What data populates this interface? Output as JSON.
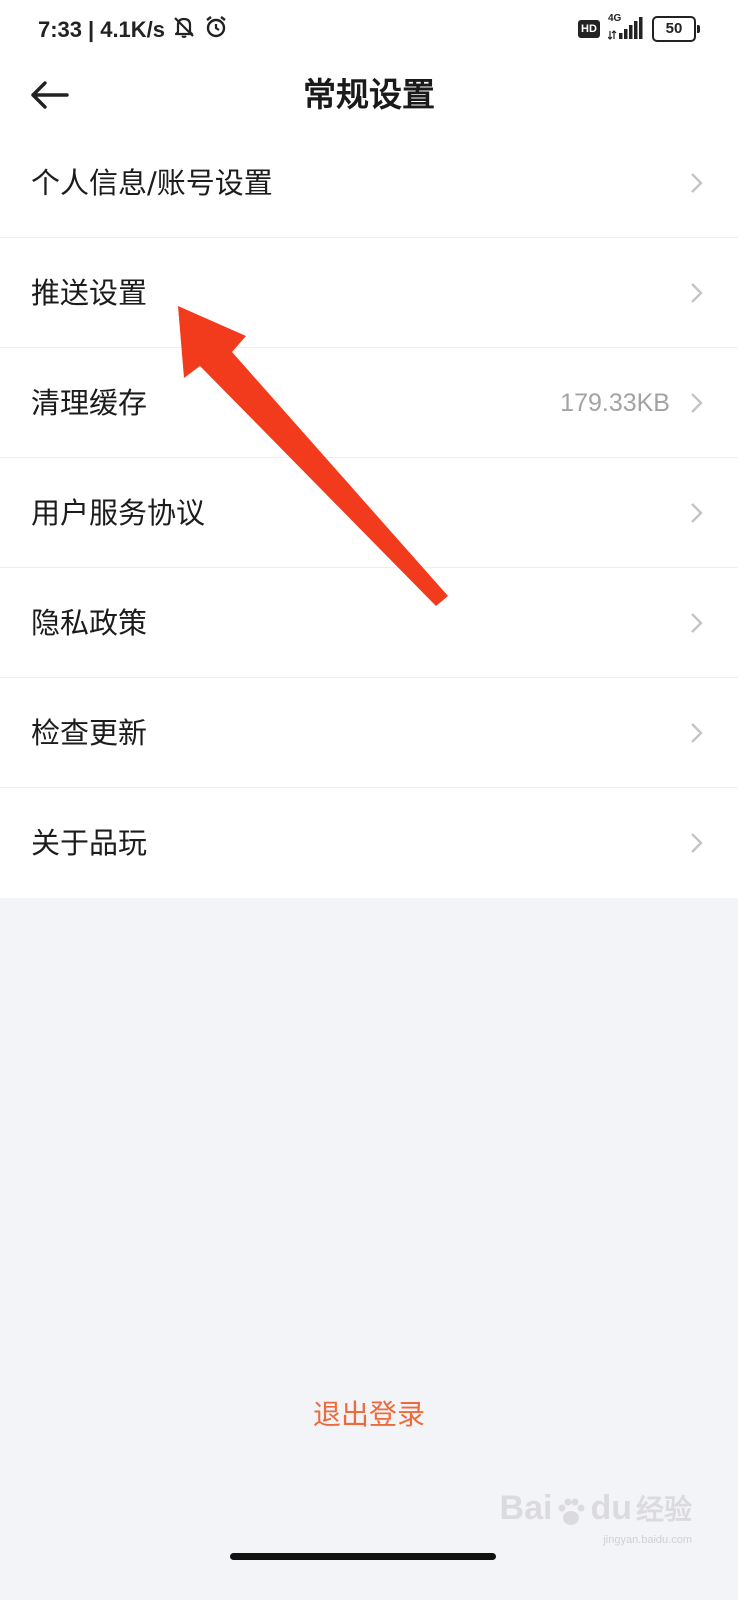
{
  "status_bar": {
    "time": "7:33",
    "separator": "|",
    "net_speed": "4.1K/s",
    "hd_label": "HD",
    "network_label": "4G",
    "battery": "50",
    "icons": [
      "mute-icon",
      "alarm-icon",
      "hd-icon",
      "signal-icon",
      "battery-icon"
    ]
  },
  "nav": {
    "title": "常规设置",
    "back_icon": "arrow-left-icon"
  },
  "menu": {
    "items": [
      {
        "label": "个人信息/账号设置",
        "value": ""
      },
      {
        "label": "推送设置",
        "value": ""
      },
      {
        "label": "清理缓存",
        "value": "179.33KB"
      },
      {
        "label": "用户服务协议",
        "value": ""
      },
      {
        "label": "隐私政策",
        "value": ""
      },
      {
        "label": "检查更新",
        "value": ""
      },
      {
        "label": "关于品玩",
        "value": ""
      }
    ]
  },
  "logout": {
    "label": "退出登录"
  },
  "watermark": {
    "text": "Bai",
    "text2": "du",
    "cn": "经验",
    "sub": "jingyan.baidu.com"
  },
  "colors": {
    "accent": "#ef6a3a",
    "annotation_arrow": "#f23a1c",
    "background": "#f3f4f8"
  }
}
